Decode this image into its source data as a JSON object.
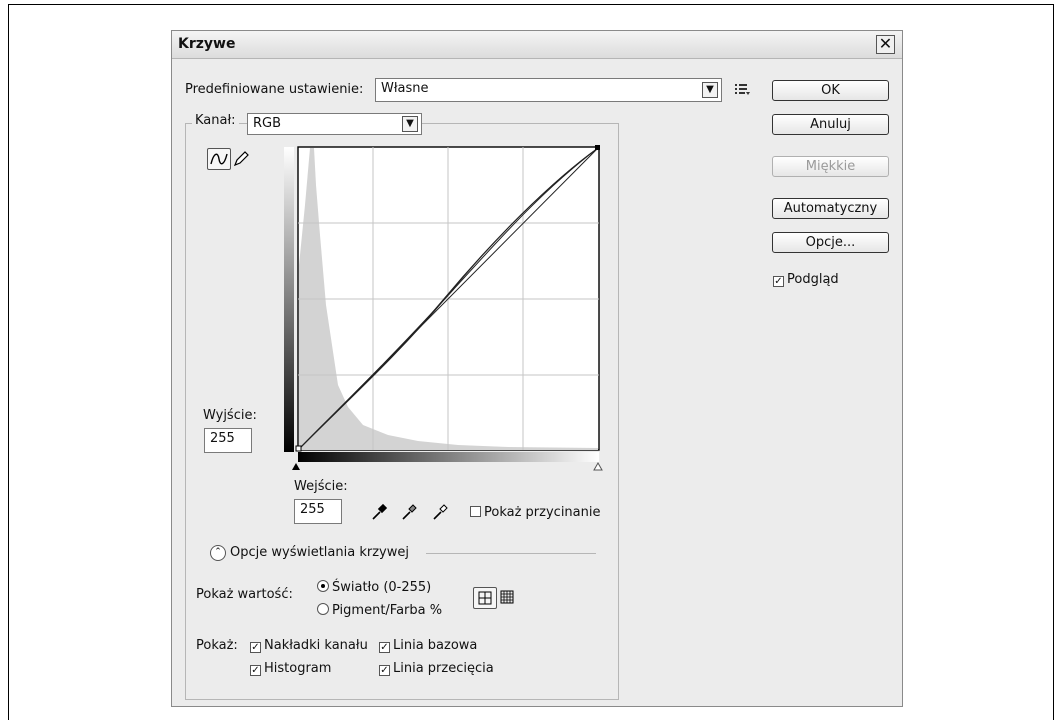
{
  "title": "Krzywe",
  "preset": {
    "label": "Predefiniowane ustawienie:",
    "value": "Własne"
  },
  "channel": {
    "label": "Kanał:",
    "value": "RGB"
  },
  "buttons": {
    "ok": "OK",
    "cancel": "Anuluj",
    "smooth": "Miękkie",
    "auto": "Automatyczny",
    "options": "Opcje..."
  },
  "preview": {
    "label": "Podgląd",
    "checked": true
  },
  "output": {
    "label": "Wyjście:",
    "value": "255"
  },
  "input": {
    "label": "Wejście:",
    "value": "255"
  },
  "show_clipping": {
    "label": "Pokaż przycinanie",
    "checked": false
  },
  "curve_display_options": {
    "label": "Opcje wyświetlania krzywej"
  },
  "show_amount": {
    "label": "Pokaż wartość:",
    "light": "Światło (0-255)",
    "pigment": "Pigment/Farba %",
    "selected": "light"
  },
  "show": {
    "label": "Pokaż:",
    "channel_overlays": "Nakładki kanału",
    "baseline": "Linia bazowa",
    "histogram": "Histogram",
    "intersection_line": "Linia przecięcia"
  },
  "icons": {
    "preset_menu": "preset-options-icon",
    "curve_tool": "curve-point-icon",
    "pencil_tool": "pencil-icon",
    "eyedroppers": [
      "black-point-eyedropper-icon",
      "gray-point-eyedropper-icon",
      "white-point-eyedropper-icon"
    ],
    "collapse": "collapse-chevron-icon",
    "grid_simple": "simple-grid-icon",
    "grid_detailed": "detailed-grid-icon",
    "close": "close-icon"
  }
}
